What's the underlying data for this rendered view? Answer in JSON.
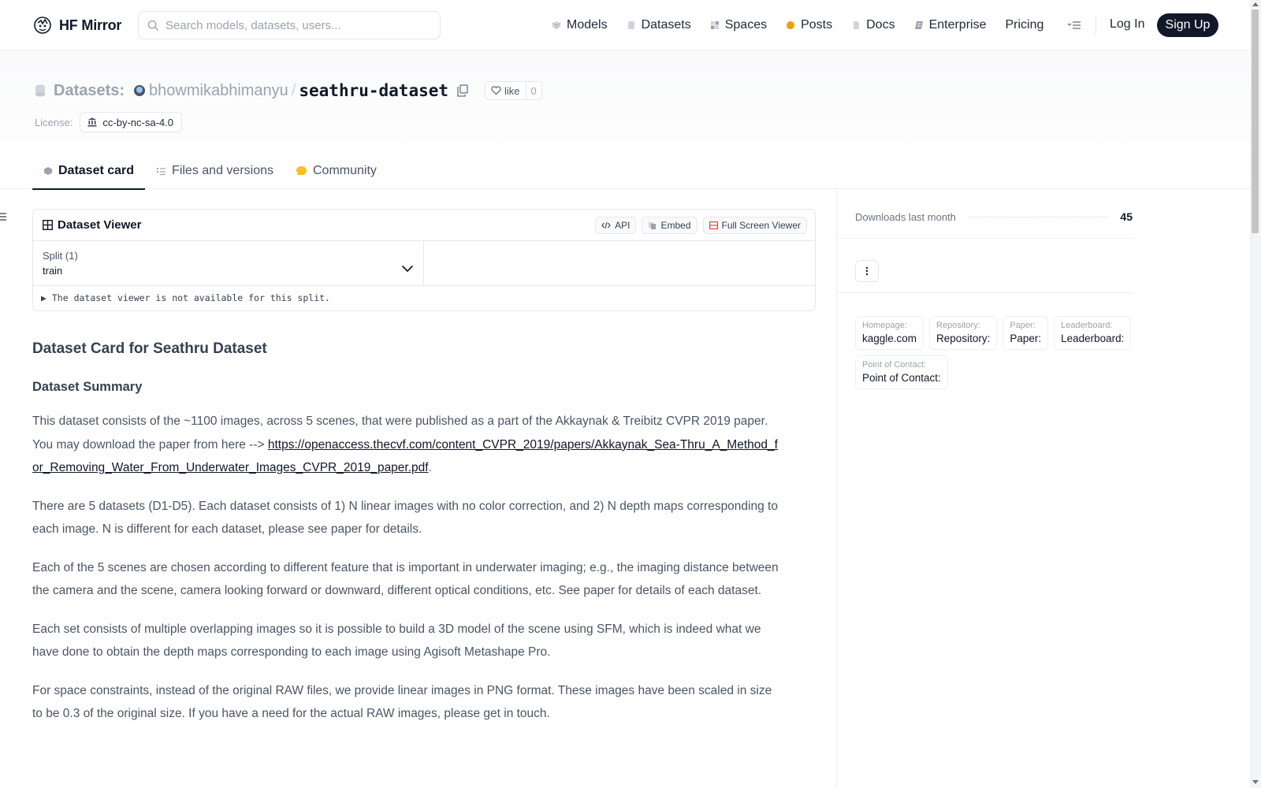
{
  "app": {
    "brand": "HF Mirror",
    "search_placeholder": "Search models, datasets, users..."
  },
  "nav": {
    "links": [
      {
        "label": "Models",
        "icon": "cube-icon",
        "color": "#9ca3af"
      },
      {
        "label": "Datasets",
        "icon": "database-icon",
        "color": "#9ca3af"
      },
      {
        "label": "Spaces",
        "icon": "grid-icon",
        "color": "#9ca3af"
      },
      {
        "label": "Posts",
        "icon": "speech-bubble-icon",
        "color": "#f59e0b"
      },
      {
        "label": "Docs",
        "icon": "document-icon",
        "color": "#9ca3af"
      },
      {
        "label": "Enterprise",
        "icon": "enterprise-icon",
        "color": "#6b7280"
      },
      {
        "label": "Pricing",
        "icon": "",
        "color": ""
      }
    ],
    "login": "Log In",
    "signup": "Sign Up"
  },
  "header": {
    "type_label": "Datasets:",
    "owner": "bhowmikabhimanyu",
    "separator": "/",
    "repo": "seathru-dataset",
    "like_label": "like",
    "like_count": "0",
    "license_label": "License:",
    "license_value": "cc-by-nc-sa-4.0"
  },
  "tabs": [
    {
      "label": "Dataset card",
      "active": true,
      "icon": "dataset-card-icon"
    },
    {
      "label": "Files and versions",
      "active": false,
      "icon": "files-icon"
    },
    {
      "label": "Community",
      "active": false,
      "icon": "community-icon"
    }
  ],
  "viewer": {
    "title": "Dataset Viewer",
    "buttons": {
      "api": "API",
      "embed": "Embed",
      "fullscreen": "Full Screen Viewer"
    },
    "split_label": "Split (1)",
    "split_value": "train",
    "message": "The dataset viewer is not available for this split."
  },
  "card": {
    "title": "Dataset Card for Seathru Dataset",
    "summary_heading": "Dataset Summary",
    "p1_text": "This dataset consists of the ~1100 images, across 5 scenes, that were published as a part of the Akkaynak & Treibitz CVPR 2019 paper. You may download the paper from here --> ",
    "p1_link": "https://openaccess.thecvf.com/content_CVPR_2019/papers/Akkaynak_Sea-Thru_A_Method_for_Removing_Water_From_Underwater_Images_CVPR_2019_paper.pdf",
    "p1_end": ".",
    "p2": "There are 5 datasets (D1-D5). Each dataset consists of 1) N linear images with no color correction, and 2) N depth maps corresponding to each image. N is different for each dataset, please see paper for details.",
    "p3": "Each of the 5 scenes are chosen according to different feature that is important in underwater imaging; e.g., the imaging distance between the camera and the scene, camera looking forward or downward, different optical conditions, etc. See paper for details of each dataset.",
    "p4": "Each set consists of multiple overlapping images so it is possible to build a 3D model of the scene using SFM, which is indeed what we have done to obtain the depth maps corresponding to each image using Agisoft Metashape Pro.",
    "p5": "For space constraints, instead of the original RAW files, we provide linear images in PNG format. These images have been scaled in size to be 0.3 of the original size. If you have a need for the actual RAW images, please get in touch."
  },
  "sidebar": {
    "downloads_label": "Downloads last month",
    "downloads_value": "45",
    "meta": [
      {
        "key": "Homepage:",
        "value": "kaggle.com"
      },
      {
        "key": "Repository:",
        "value": "Repository:"
      },
      {
        "key": "Paper:",
        "value": "Paper:"
      },
      {
        "key": "Leaderboard:",
        "value": "Leaderboard:"
      },
      {
        "key": "Point of Contact:",
        "value": "Point of Contact:"
      }
    ]
  },
  "colors": {
    "accent_dark": "#111827",
    "text_muted": "#9ca3af",
    "posts_icon": "#f59e0b",
    "fullscreen_icon": "#ef4444"
  }
}
